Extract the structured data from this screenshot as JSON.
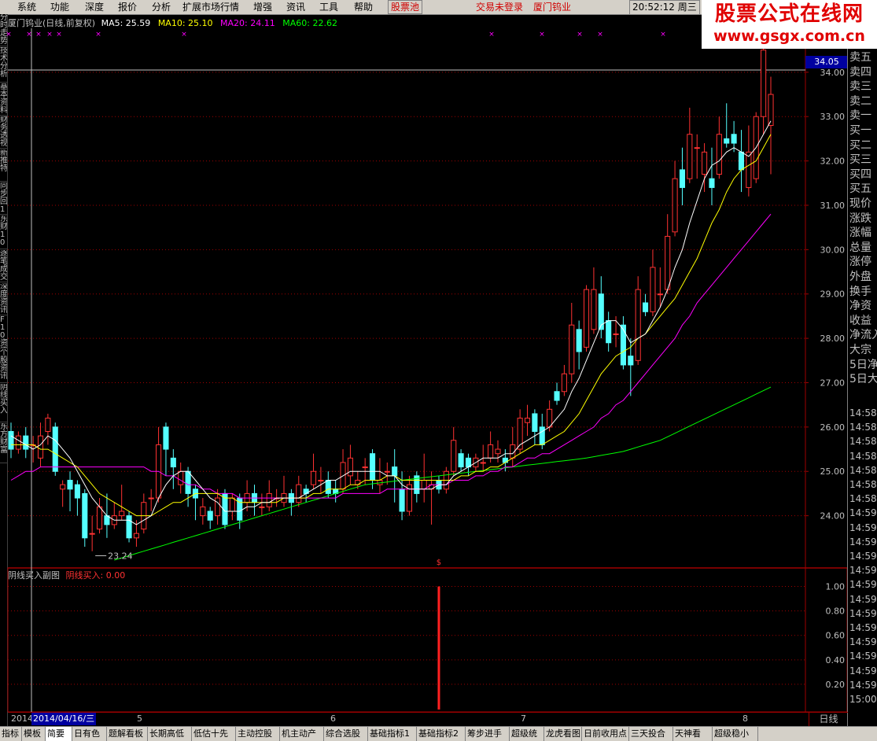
{
  "menu": {
    "items": [
      "系统",
      "功能",
      "深度",
      "报价",
      "分析",
      "扩展市场行情",
      "增强",
      "资讯",
      "工具",
      "帮助"
    ],
    "stock_pool": "股票池",
    "trade_status": "交易未登录",
    "stock_name": "厦门钨业",
    "clock": "20:52:12 周三"
  },
  "watermark": {
    "line1": "股票公式在线网",
    "line2": "www.gsgx.com.cn"
  },
  "left_tabs": [
    "分时走势",
    "技术分析",
    "基本资料",
    "财务透视",
    "新推特",
    "同步回10",
    "东财10",
    "逐笔成交",
    "深度资讯",
    "F10资讯",
    "个股资讯",
    "阴线买入",
    "东方财富"
  ],
  "main_header": {
    "title": "厦门钨业(日线,前复权)",
    "ma5_label": "MA5: 25.59",
    "ma5_color": "#ffffff",
    "ma10_label": "MA10: 25.10",
    "ma10_color": "#ffff00",
    "ma20_label": "MA20: 24.11",
    "ma20_color": "#ff00ff",
    "ma60_label": "MA60: 22.62",
    "ma60_color": "#00ff00"
  },
  "sub_header": {
    "title": "阴线买入副图",
    "value_label": "阴线买入: 0.00"
  },
  "price_axis": {
    "ticks": [
      "34.00",
      "33.00",
      "32.00",
      "31.00",
      "30.00",
      "29.00",
      "28.00",
      "27.00",
      "26.00",
      "25.00",
      "24.00"
    ],
    "current": "34.05"
  },
  "sub_axis": {
    "ticks": [
      "1.00",
      "0.80",
      "0.60",
      "0.40",
      "0.20"
    ]
  },
  "annotations": {
    "low_label": "23.24",
    "signal_mark": "$"
  },
  "right_panel": {
    "labels": [
      "卖五",
      "卖四",
      "卖三",
      "卖二",
      "卖一",
      "买一",
      "买二",
      "买三",
      "买四",
      "买五",
      "现价",
      "涨跌",
      "涨幅",
      "总量",
      "涨停",
      "外盘",
      "换手",
      "净资",
      "收益",
      "净流入",
      "大宗",
      "5日净",
      "5日大"
    ],
    "times": [
      "14:58",
      "14:58",
      "14:58",
      "14:58",
      "14:58",
      "14:58",
      "14:58",
      "14:59",
      "14:59",
      "14:59",
      "14:59",
      "14:59",
      "14:59",
      "14:59",
      "14:59",
      "14:59",
      "14:59",
      "14:59",
      "14:59",
      "14:59",
      "15:00"
    ]
  },
  "date_bar": {
    "year": "2014",
    "cursor_date": "2014/04/16/三",
    "months": [
      "5",
      "6",
      "7",
      "8"
    ],
    "period": "日线"
  },
  "bottom_tabs": [
    "指标",
    "模板",
    "简要",
    "日有色",
    "题解看板",
    "长期高低",
    "低估十先",
    "主动控股",
    "机主动产",
    "综合选股",
    "基础指标1",
    "基础指标2",
    "筹步进手",
    "超级统",
    "龙虎看图",
    "日前收用点",
    "三天投合",
    "天神看",
    "超级稳小"
  ],
  "colors": {
    "up": "#ff3232",
    "down": "#54ffff",
    "grid": "#a00000"
  },
  "chart_data": {
    "type": "candlestick",
    "title": "厦门钨业(日线,前复权)",
    "ylim": [
      23.0,
      34.6
    ],
    "candles": [
      [
        25.9,
        25.5,
        26.1,
        25.3
      ],
      [
        25.5,
        25.8,
        25.9,
        25.4
      ],
      [
        25.8,
        25.5,
        26.0,
        25.3
      ],
      [
        25.6,
        25.6,
        25.8,
        25.2
      ],
      [
        25.3,
        25.8,
        26.1,
        25.1
      ],
      [
        25.9,
        26.2,
        26.3,
        25.6
      ],
      [
        26.0,
        25.0,
        26.1,
        24.9
      ],
      [
        24.6,
        24.7,
        24.8,
        24.2
      ],
      [
        24.8,
        24.6,
        25.0,
        24.1
      ],
      [
        24.7,
        24.4,
        24.8,
        24.0
      ],
      [
        24.5,
        23.5,
        24.6,
        23.3
      ],
      [
        23.6,
        23.6,
        24.0,
        23.2
      ],
      [
        23.7,
        24.2,
        24.4,
        23.6
      ],
      [
        24.0,
        23.8,
        24.5,
        23.5
      ],
      [
        23.8,
        24.0,
        24.3,
        23.7
      ],
      [
        24.0,
        24.1,
        24.7,
        23.9
      ],
      [
        24.0,
        23.5,
        24.1,
        23.4
      ],
      [
        23.5,
        23.6,
        23.9,
        23.3
      ],
      [
        23.7,
        24.3,
        24.5,
        23.6
      ],
      [
        24.4,
        24.4,
        24.6,
        24.1
      ],
      [
        24.4,
        25.6,
        26.0,
        24.3
      ],
      [
        26.0,
        25.5,
        26.1,
        24.9
      ],
      [
        25.3,
        25.1,
        25.5,
        24.6
      ],
      [
        24.7,
        25.0,
        25.2,
        24.5
      ],
      [
        25.0,
        24.5,
        25.1,
        24.2
      ],
      [
        24.6,
        24.4,
        24.7,
        23.9
      ],
      [
        24.0,
        24.2,
        24.4,
        23.8
      ],
      [
        24.1,
        23.9,
        24.2,
        23.7
      ],
      [
        24.0,
        24.4,
        24.6,
        23.8
      ],
      [
        24.5,
        23.8,
        24.6,
        23.7
      ],
      [
        24.1,
        24.4,
        24.5,
        23.9
      ],
      [
        24.4,
        23.9,
        24.5,
        23.7
      ],
      [
        24.3,
        24.5,
        24.8,
        24.1
      ],
      [
        24.5,
        24.3,
        24.7,
        24.0
      ],
      [
        24.2,
        24.2,
        24.5,
        24.0
      ],
      [
        24.2,
        24.5,
        24.8,
        24.1
      ],
      [
        24.4,
        24.4,
        24.6,
        24.2
      ],
      [
        24.3,
        24.5,
        24.9,
        24.2
      ],
      [
        24.5,
        24.3,
        24.6,
        24.0
      ],
      [
        24.3,
        24.7,
        24.9,
        24.2
      ],
      [
        24.6,
        24.5,
        24.7,
        24.3
      ],
      [
        24.7,
        25.0,
        25.4,
        24.6
      ],
      [
        24.8,
        24.8,
        25.1,
        24.5
      ],
      [
        24.8,
        24.5,
        25.0,
        24.4
      ],
      [
        24.6,
        24.5,
        24.8,
        24.3
      ],
      [
        24.6,
        25.2,
        25.5,
        24.5
      ],
      [
        24.9,
        25.3,
        25.6,
        24.7
      ],
      [
        24.7,
        24.8,
        25.0,
        24.6
      ],
      [
        25.1,
        25.1,
        25.3,
        24.7
      ],
      [
        25.4,
        24.8,
        25.5,
        24.6
      ],
      [
        24.7,
        24.8,
        25.3,
        24.5
      ],
      [
        25.0,
        25.0,
        25.2,
        24.7
      ],
      [
        25.1,
        24.9,
        25.5,
        24.3
      ],
      [
        24.6,
        24.1,
        25.0,
        23.9
      ],
      [
        24.1,
        24.7,
        24.9,
        24.0
      ],
      [
        24.9,
        24.5,
        25.0,
        24.3
      ],
      [
        24.6,
        24.8,
        25.4,
        24.3
      ],
      [
        24.6,
        24.7,
        25.0,
        23.8
      ],
      [
        24.8,
        24.6,
        24.9,
        24.5
      ],
      [
        24.6,
        25.0,
        25.1,
        24.5
      ],
      [
        25.0,
        25.7,
        26.0,
        24.9
      ],
      [
        25.4,
        25.1,
        25.5,
        25.0
      ],
      [
        25.3,
        25.1,
        25.4,
        24.9
      ],
      [
        25.1,
        25.3,
        25.4,
        25.0
      ],
      [
        25.2,
        25.2,
        25.6,
        25.0
      ],
      [
        25.3,
        25.6,
        25.9,
        25.2
      ],
      [
        25.4,
        25.5,
        25.7,
        25.2
      ],
      [
        25.3,
        25.2,
        25.5,
        25.0
      ],
      [
        25.3,
        25.6,
        26.0,
        25.1
      ],
      [
        25.5,
        26.2,
        26.4,
        25.4
      ],
      [
        26.1,
        26.2,
        26.5,
        25.8
      ],
      [
        26.3,
        25.9,
        26.4,
        25.6
      ],
      [
        26.0,
        25.6,
        26.3,
        25.5
      ],
      [
        26.0,
        26.4,
        26.6,
        25.9
      ],
      [
        26.8,
        26.6,
        27.0,
        26.5
      ],
      [
        26.8,
        27.2,
        27.4,
        26.7
      ],
      [
        27.2,
        28.3,
        28.8,
        27.0
      ],
      [
        28.2,
        27.7,
        28.4,
        27.3
      ],
      [
        27.8,
        29.1,
        29.2,
        27.7
      ],
      [
        28.2,
        29.1,
        29.6,
        28.1
      ],
      [
        29.0,
        28.2,
        29.4,
        28.0
      ],
      [
        28.4,
        27.9,
        28.6,
        27.7
      ],
      [
        28.1,
        28.1,
        28.5,
        27.8
      ],
      [
        28.3,
        27.4,
        28.5,
        27.3
      ],
      [
        27.6,
        27.4,
        28.0,
        26.7
      ],
      [
        27.5,
        29.1,
        29.4,
        27.4
      ],
      [
        28.8,
        28.6,
        29.0,
        28.5
      ],
      [
        28.6,
        29.6,
        30.0,
        28.5
      ],
      [
        29.0,
        29.0,
        29.6,
        28.7
      ],
      [
        29.1,
        30.3,
        30.8,
        29.0
      ],
      [
        30.4,
        31.6,
        32.0,
        30.3
      ],
      [
        31.8,
        31.4,
        32.3,
        31.0
      ],
      [
        31.6,
        32.6,
        33.2,
        31.5
      ],
      [
        32.3,
        32.3,
        32.6,
        31.6
      ],
      [
        31.7,
        32.2,
        32.4,
        31.3
      ],
      [
        31.6,
        31.4,
        32.3,
        31.0
      ],
      [
        31.7,
        32.6,
        33.0,
        31.6
      ],
      [
        32.5,
        32.4,
        33.3,
        32.3
      ],
      [
        32.6,
        32.4,
        32.9,
        32.2
      ],
      [
        32.2,
        31.8,
        32.7,
        31.3
      ],
      [
        31.4,
        32.2,
        32.8,
        31.2
      ],
      [
        31.6,
        33.0,
        33.1,
        31.5
      ],
      [
        33.0,
        34.5,
        34.9,
        32.6
      ],
      [
        32.8,
        33.5,
        33.9,
        31.7
      ]
    ],
    "ma5": [
      25.8,
      25.7,
      25.6,
      25.5,
      25.6,
      25.8,
      25.7,
      25.5,
      25.3,
      25.0,
      24.7,
      24.4,
      24.2,
      24.0,
      23.9,
      23.9,
      23.9,
      23.8,
      23.9,
      24.0,
      24.4,
      24.7,
      24.9,
      25.0,
      25.0,
      24.8,
      24.6,
      24.4,
      24.3,
      24.1,
      24.1,
      24.1,
      24.2,
      24.2,
      24.3,
      24.3,
      24.4,
      24.4,
      24.4,
      24.4,
      24.5,
      24.6,
      24.7,
      24.8,
      24.8,
      24.9,
      25.0,
      25.0,
      25.0,
      25.0,
      25.0,
      24.9,
      24.9,
      24.7,
      24.6,
      24.6,
      24.6,
      24.6,
      24.7,
      24.7,
      24.9,
      25.0,
      25.1,
      25.2,
      25.3,
      25.3,
      25.3,
      25.4,
      25.4,
      25.6,
      25.7,
      25.8,
      25.9,
      26.0,
      26.2,
      26.4,
      26.8,
      27.1,
      27.5,
      27.9,
      28.3,
      28.4,
      28.4,
      28.2,
      27.9,
      28.0,
      28.1,
      28.4,
      28.7,
      29.1,
      29.6,
      30.0,
      30.6,
      31.1,
      31.6,
      31.9,
      32.0,
      32.2,
      32.3,
      32.2,
      32.1,
      32.3,
      32.6,
      32.9
    ],
    "ma10": [
      25.6,
      25.6,
      25.6,
      25.6,
      25.5,
      25.5,
      25.4,
      25.3,
      25.2,
      25.1,
      24.9,
      24.7,
      24.5,
      24.4,
      24.3,
      24.2,
      24.1,
      24.0,
      24.0,
      24.0,
      24.1,
      24.2,
      24.3,
      24.3,
      24.4,
      24.5,
      24.5,
      24.5,
      24.5,
      24.4,
      24.4,
      24.3,
      24.3,
      24.3,
      24.3,
      24.3,
      24.3,
      24.4,
      24.4,
      24.4,
      24.4,
      24.5,
      24.5,
      24.6,
      24.6,
      24.6,
      24.7,
      24.7,
      24.8,
      24.8,
      24.8,
      24.9,
      24.9,
      24.8,
      24.8,
      24.8,
      24.8,
      24.8,
      24.8,
      24.8,
      24.8,
      24.9,
      24.9,
      25.0,
      25.0,
      25.1,
      25.1,
      25.2,
      25.3,
      25.4,
      25.5,
      25.6,
      25.6,
      25.7,
      25.8,
      25.9,
      26.1,
      26.3,
      26.6,
      26.9,
      27.2,
      27.4,
      27.6,
      27.7,
      27.8,
      28.0,
      28.1,
      28.3,
      28.5,
      28.7,
      28.9,
      29.2,
      29.5,
      29.8,
      30.2,
      30.6,
      30.9,
      31.3,
      31.6,
      31.8,
      31.9,
      32.0,
      32.3,
      32.6
    ],
    "ma20": [
      24.8,
      24.9,
      25.0,
      25.0,
      25.1,
      25.1,
      25.1,
      25.1,
      25.1,
      25.1,
      25.1,
      25.1,
      25.1,
      25.1,
      25.1,
      25.1,
      25.1,
      25.1,
      25.1,
      25.0,
      25.0,
      24.9,
      24.9,
      24.8,
      24.7,
      24.7,
      24.6,
      24.6,
      24.5,
      24.5,
      24.5,
      24.4,
      24.4,
      24.4,
      24.4,
      24.4,
      24.4,
      24.4,
      24.4,
      24.4,
      24.4,
      24.4,
      24.4,
      24.4,
      24.4,
      24.5,
      24.5,
      24.5,
      24.5,
      24.5,
      24.5,
      24.6,
      24.6,
      24.6,
      24.6,
      24.6,
      24.6,
      24.7,
      24.7,
      24.7,
      24.8,
      24.8,
      24.8,
      24.9,
      24.9,
      25.0,
      25.0,
      25.1,
      25.1,
      25.2,
      25.3,
      25.3,
      25.4,
      25.4,
      25.5,
      25.6,
      25.7,
      25.8,
      25.9,
      26.0,
      26.2,
      26.3,
      26.5,
      26.6,
      26.8,
      27.0,
      27.2,
      27.4,
      27.6,
      27.8,
      28.0,
      28.3,
      28.5,
      28.8,
      29.0,
      29.2,
      29.4,
      29.6,
      29.8,
      30.0,
      30.2,
      30.4,
      30.6,
      30.8
    ],
    "ma60": [
      null,
      null,
      null,
      null,
      null,
      null,
      null,
      null,
      null,
      null,
      null,
      null,
      null,
      null,
      23.0,
      23.05,
      23.1,
      23.15,
      23.2,
      23.25,
      23.3,
      23.35,
      23.4,
      23.45,
      23.5,
      23.55,
      23.6,
      23.65,
      23.7,
      23.75,
      23.8,
      23.85,
      23.9,
      23.95,
      24.0,
      24.05,
      24.1,
      24.15,
      24.2,
      24.25,
      24.3,
      24.35,
      24.4,
      24.45,
      24.5,
      24.55,
      24.6,
      24.65,
      24.7,
      24.72,
      24.74,
      24.76,
      24.78,
      24.8,
      24.82,
      24.84,
      24.86,
      24.88,
      24.9,
      24.92,
      24.94,
      24.96,
      24.98,
      25.0,
      25.02,
      25.04,
      25.06,
      25.08,
      25.1,
      25.12,
      25.14,
      25.16,
      25.18,
      25.2,
      25.22,
      25.24,
      25.26,
      25.28,
      25.3,
      25.33,
      25.36,
      25.39,
      25.42,
      25.45,
      25.5,
      25.55,
      25.6,
      25.65,
      25.7,
      25.78,
      25.86,
      25.94,
      26.02,
      26.1,
      26.18,
      26.26,
      26.34,
      26.42,
      26.5,
      26.58,
      26.66,
      26.74,
      26.82,
      26.9
    ],
    "sub_signal_index": 58,
    "sub_signal_value": 1.0,
    "sub_ylim": [
      0,
      1.1
    ]
  }
}
